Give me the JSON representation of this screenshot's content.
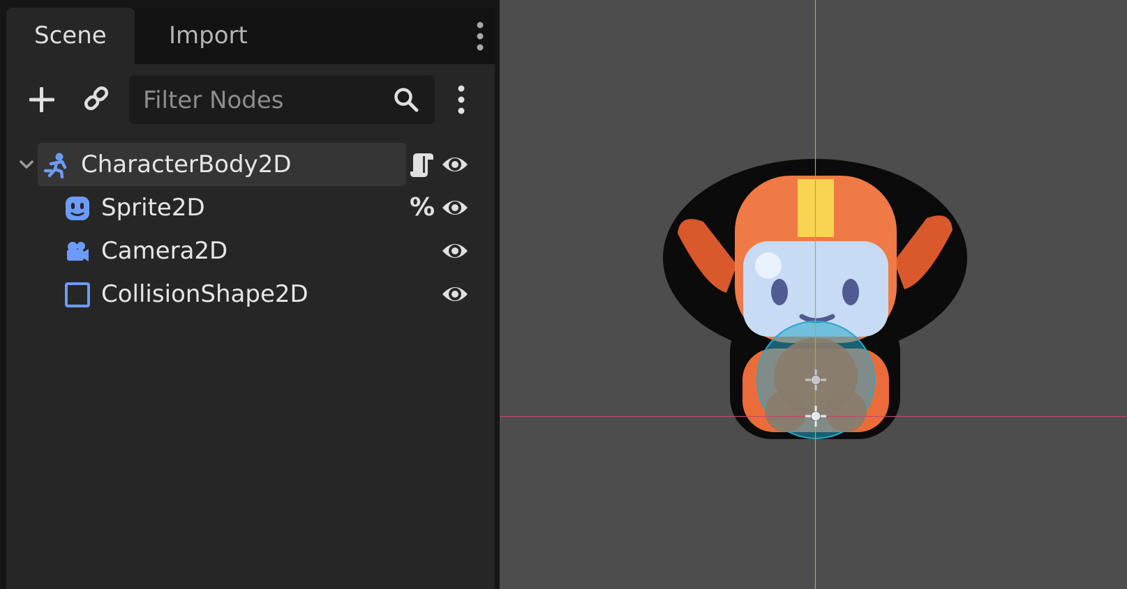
{
  "scene_dock": {
    "tabs": [
      {
        "label": "Scene",
        "active": true
      },
      {
        "label": "Import",
        "active": false
      }
    ],
    "toolbar": {
      "add_icon": "plus-icon",
      "link_icon": "link-icon",
      "filter_placeholder": "Filter Nodes",
      "filter_value": "",
      "search_icon": "search-icon",
      "menu_icon": "vertical-dots-icon"
    },
    "tree": {
      "nodes": [
        {
          "label": "CharacterBody2D",
          "icon": "character-body-2d-icon",
          "expanded": true,
          "selected": true,
          "attached": "script-icon",
          "visible": true
        },
        {
          "label": "Sprite2D",
          "icon": "sprite-2d-icon",
          "attached": "unique-name-icon",
          "attached_text": "%",
          "visible": true
        },
        {
          "label": "Camera2D",
          "icon": "camera-2d-icon",
          "visible": true
        },
        {
          "label": "CollisionShape2D",
          "icon": "collision-shape-2d-icon",
          "visible": true
        }
      ]
    }
  },
  "viewport": {
    "background": "#4d4d4d",
    "y_axis_color": "#8fbf2f",
    "x_axis_color": "#c2466f",
    "collision_shape": "circle",
    "collision_color": "#2aa8c8"
  },
  "colors": {
    "panel": "#262626",
    "dark": "#161616",
    "node_icon": "#6c9bfa",
    "text": "#e0e0e0"
  }
}
